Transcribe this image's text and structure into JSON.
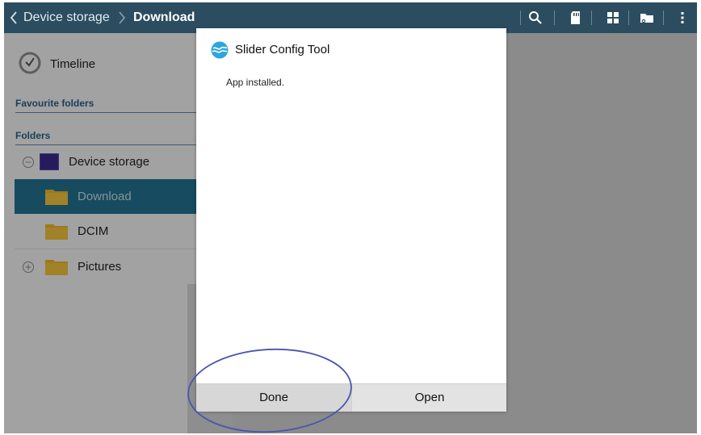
{
  "topbar": {
    "breadcrumb_root": "Device storage",
    "breadcrumb_current": "Download",
    "icons": [
      "search-icon",
      "sd-card-icon",
      "grid-view-icon",
      "folder-share-icon",
      "overflow-menu-icon"
    ]
  },
  "sidebar": {
    "timeline_label": "Timeline",
    "favourite_folders_header": "Favourite folders",
    "folders_header": "Folders",
    "items": [
      {
        "label": "Device storage",
        "state": "expanded"
      },
      {
        "label": "Download",
        "selected": true
      },
      {
        "label": "DCIM"
      },
      {
        "label": "Pictures",
        "state": "collapsed"
      }
    ]
  },
  "dialog": {
    "title": "Slider Config Tool",
    "message": "App installed.",
    "buttons": {
      "done": "Done",
      "open": "Open"
    }
  },
  "colors": {
    "action_bar": "#2b4d5f",
    "selection": "#22708f",
    "section_header_text": "#2a5d86",
    "folder_yellow": "#e9b52e",
    "annotation_ellipse": "#4a55b0"
  }
}
